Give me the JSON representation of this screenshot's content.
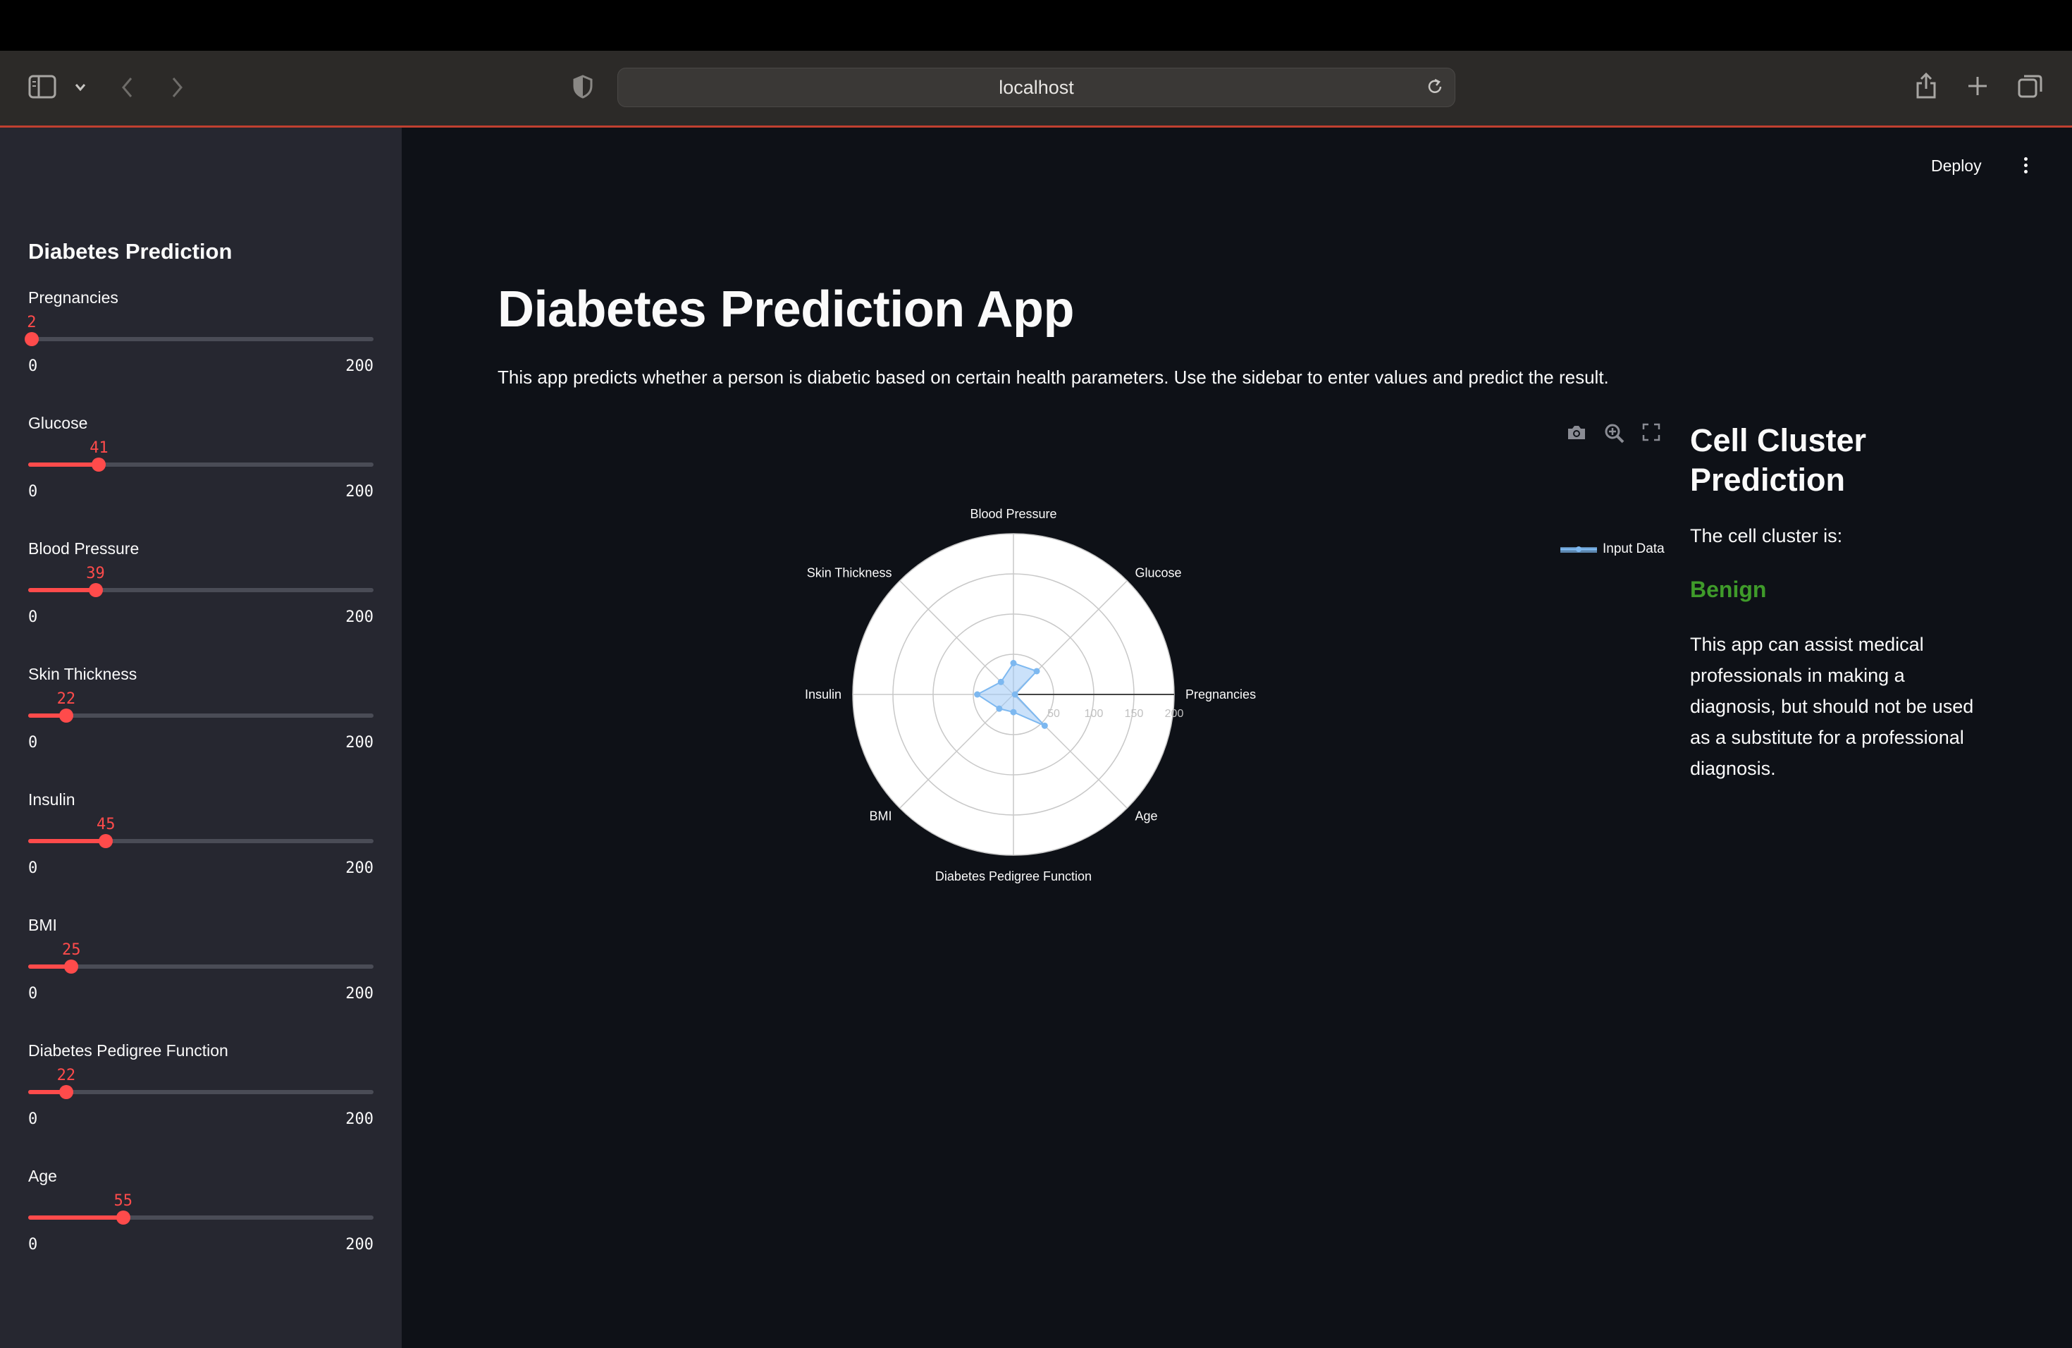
{
  "browser": {
    "url": "localhost"
  },
  "header": {
    "deploy_label": "Deploy"
  },
  "sidebar": {
    "title": "Diabetes Prediction",
    "sliders": [
      {
        "label": "Pregnancies",
        "value": 2,
        "min": "0",
        "max": "200"
      },
      {
        "label": "Glucose",
        "value": 41,
        "min": "0",
        "max": "200"
      },
      {
        "label": "Blood Pressure",
        "value": 39,
        "min": "0",
        "max": "200"
      },
      {
        "label": "Skin Thickness",
        "value": 22,
        "min": "0",
        "max": "200"
      },
      {
        "label": "Insulin",
        "value": 45,
        "min": "0",
        "max": "200"
      },
      {
        "label": "BMI",
        "value": 25,
        "min": "0",
        "max": "200"
      },
      {
        "label": "Diabetes Pedigree Function",
        "value": 22,
        "min": "0",
        "max": "200"
      },
      {
        "label": "Age",
        "value": 55,
        "min": "0",
        "max": "200"
      }
    ]
  },
  "main": {
    "title": "Diabetes Prediction App",
    "description": "This app predicts whether a person is diabetic based on certain health parameters. Use the sidebar to enter values and predict the result."
  },
  "chart_toolbar": [
    "camera-icon",
    "zoom-icon",
    "fullscreen-icon"
  ],
  "chart_data": {
    "type": "radar",
    "categories": [
      "Pregnancies",
      "Glucose",
      "Blood Pressure",
      "Skin Thickness",
      "Insulin",
      "BMI",
      "Diabetes Pedigree Function",
      "Age"
    ],
    "series": [
      {
        "name": "Input Data",
        "values": [
          2,
          41,
          39,
          22,
          45,
          25,
          22,
          55
        ]
      }
    ],
    "radial_range": [
      0,
      200
    ],
    "radial_ticks": [
      "50",
      "100",
      "150",
      "200"
    ],
    "colors": {
      "fill": "#9ec9f5",
      "line": "#7db8f0",
      "background": "#ffffff",
      "grid": "#c8c8c8"
    }
  },
  "result_panel": {
    "title": "Cell Cluster Prediction",
    "subtitle": "The cell cluster is:",
    "result": "Benign",
    "result_color": "#3f9b2a",
    "note": "This app can assist medical professionals in making a diagnosis, but should not be used as a substitute for a professional diagnosis."
  }
}
